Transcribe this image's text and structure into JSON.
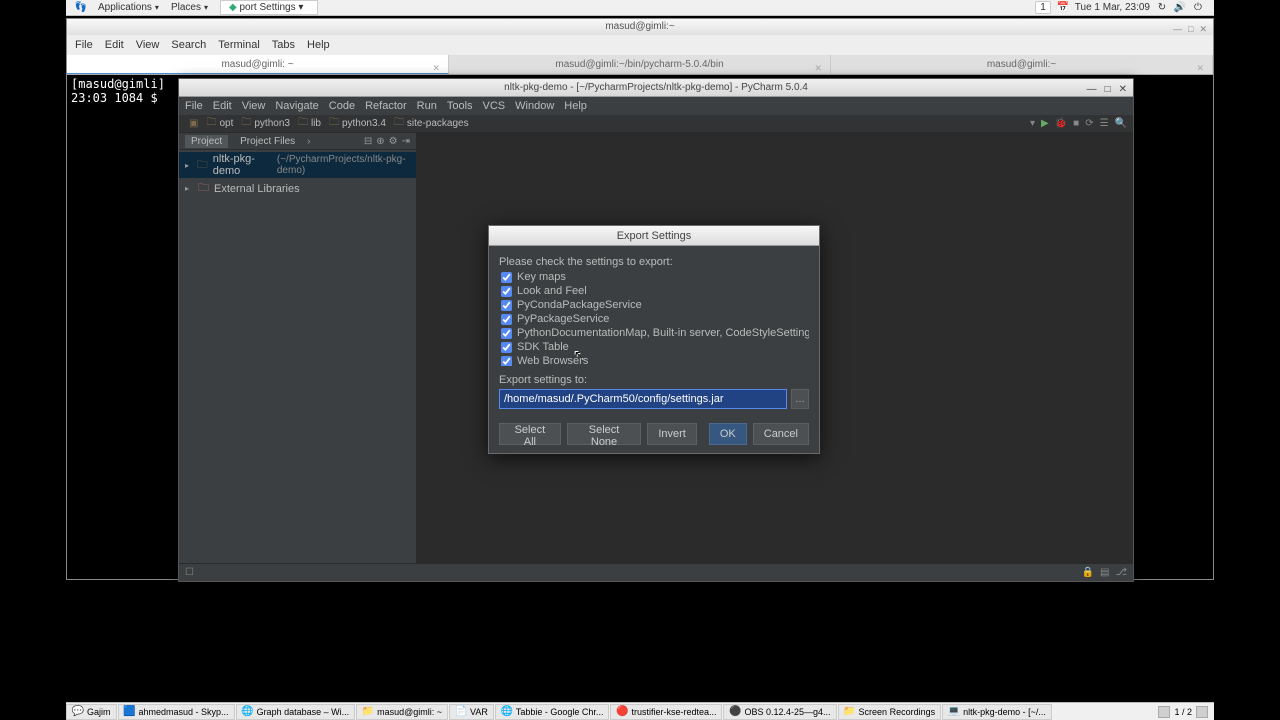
{
  "gnome": {
    "applications": "Applications",
    "places": "Places",
    "active_win": "port Settings",
    "notif_count": "1",
    "clock": "Tue  1 Mar, 23:09"
  },
  "terminal": {
    "title": "masud@gimli:~",
    "menu": [
      "File",
      "Edit",
      "View",
      "Search",
      "Terminal",
      "Tabs",
      "Help"
    ],
    "tabs": [
      "masud@gimli: ~",
      "masud@gimli:~/bin/pycharm-5.0.4/bin",
      "masud@gimli:~"
    ],
    "line1": "[masud@gimli]",
    "line2": "23:03 1084 $ "
  },
  "pycharm": {
    "title": "nltk-pkg-demo - [~/PycharmProjects/nltk-pkg-demo] - PyCharm 5.0.4",
    "menu": [
      "File",
      "Edit",
      "View",
      "Navigate",
      "Code",
      "Refactor",
      "Run",
      "Tools",
      "VCS",
      "Window",
      "Help"
    ],
    "breadcrumb": [
      "opt",
      "python3",
      "lib",
      "python3.4",
      "site-packages"
    ],
    "sidebar_tabs": {
      "project": "Project",
      "files": "Project Files"
    },
    "tree_root": "nltk-pkg-demo",
    "tree_root_path": "(~/PycharmProjects/nltk-pkg-demo)",
    "tree_ext": "External Libraries"
  },
  "dialog": {
    "title": "Export Settings",
    "msg": "Please check the settings to export:",
    "items": [
      "Key maps",
      "Look and Feel",
      "PyCondaPackageService",
      "PyPackageService",
      "PythonDocumentationMap, Built-in server, CodeStyleSettingsManag...",
      "SDK Table",
      "Web Browsers"
    ],
    "label": "Export settings to:",
    "path": "/home/masud/.PyCharm50/config/settings.jar",
    "select_all": "Select All",
    "select_none": "Select None",
    "invert": "Invert",
    "ok": "OK",
    "cancel": "Cancel"
  },
  "taskbar": {
    "items": [
      {
        "icon": "💬",
        "label": "Gajim"
      },
      {
        "icon": "🟦",
        "label": "ahmedmasud - Skyp..."
      },
      {
        "icon": "🌐",
        "label": "Graph database – Wi..."
      },
      {
        "icon": "📁",
        "label": "masud@gimli: ~"
      },
      {
        "icon": "📄",
        "label": "VAR"
      },
      {
        "icon": "🌐",
        "label": "Tabbie - Google Chr..."
      },
      {
        "icon": "🔴",
        "label": "trustifier-kse-redtea..."
      },
      {
        "icon": "⚫",
        "label": "OBS 0.12.4-25—g4..."
      },
      {
        "icon": "📁",
        "label": "Screen Recordings"
      },
      {
        "icon": "💻",
        "label": "nltk-pkg-demo - [~/..."
      }
    ],
    "workspace": "1 / 2"
  }
}
